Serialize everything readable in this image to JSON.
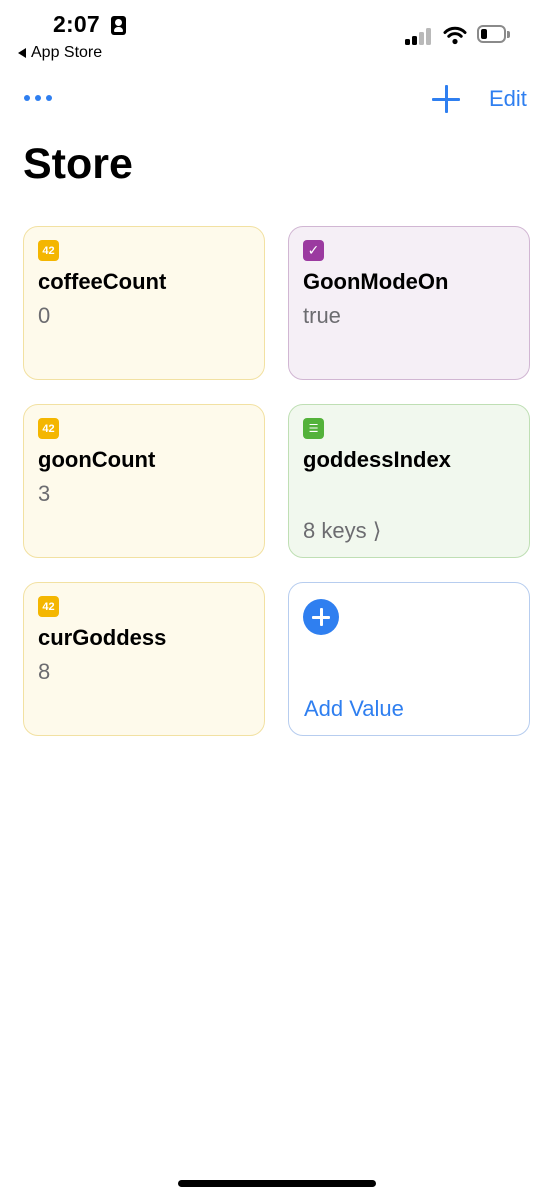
{
  "status_bar": {
    "time": "2:07",
    "back_app_label": "App Store",
    "battery_level": 0.3,
    "signal_bars_active": 2
  },
  "nav": {
    "edit_label": "Edit"
  },
  "page": {
    "title": "Store"
  },
  "cards": [
    {
      "type": "number",
      "badge": "42",
      "name": "coffeeCount",
      "value": "0"
    },
    {
      "type": "boolean",
      "badge": "✓",
      "name": "GoonModeOn",
      "value": "true"
    },
    {
      "type": "number",
      "badge": "42",
      "name": "goonCount",
      "value": "3"
    },
    {
      "type": "dictionary",
      "badge": "☰",
      "name": "goddessIndex",
      "value": "8 keys ⟩"
    },
    {
      "type": "number",
      "badge": "42",
      "name": "curGoddess",
      "value": "8"
    }
  ],
  "add_card": {
    "label": "Add Value"
  },
  "colors": {
    "accent": "#2f7ff0",
    "number": "#f4b600",
    "boolean": "#9b3aa0",
    "dictionary": "#53b23a"
  },
  "icons": {
    "more": "ellipsis-icon",
    "add": "plus-icon",
    "back": "back-triangle-icon",
    "number_badge": "number-42-icon",
    "boolean_badge": "checkbox-icon",
    "dictionary_badge": "list-icon"
  }
}
